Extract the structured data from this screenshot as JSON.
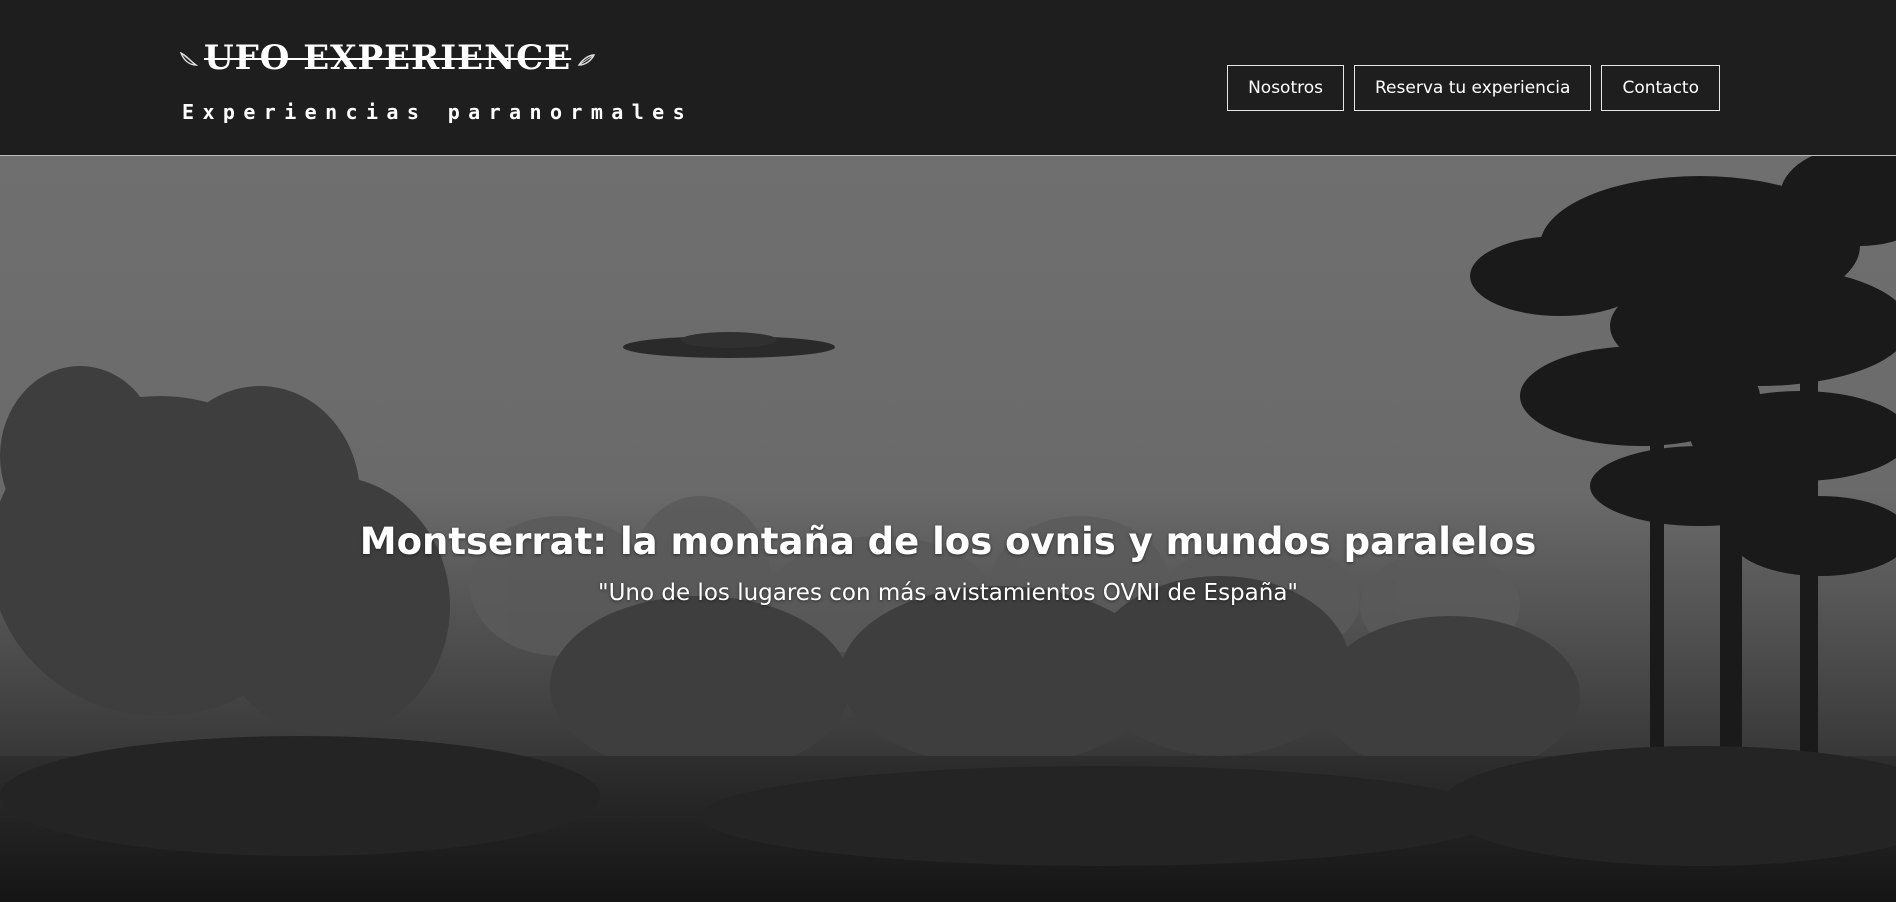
{
  "header": {
    "brand_title": "UFO EXPERIENCE",
    "brand_tagline": "Experiencias paranormales",
    "nav": [
      {
        "label": "Nosotros"
      },
      {
        "label": "Reserva tu experiencia"
      },
      {
        "label": "Contacto"
      }
    ]
  },
  "hero": {
    "title": "Montserrat: la montaña de los ovnis y mundos paralelos",
    "subtitle": "\"Uno de los lugares con más avistamientos OVNI de España\""
  },
  "colors": {
    "header_bg": "#1e1e1e",
    "text": "#ffffff",
    "button_border": "#e6e6e6"
  },
  "icons": [
    "leaf-icon",
    "ufo-image",
    "forest-image"
  ]
}
